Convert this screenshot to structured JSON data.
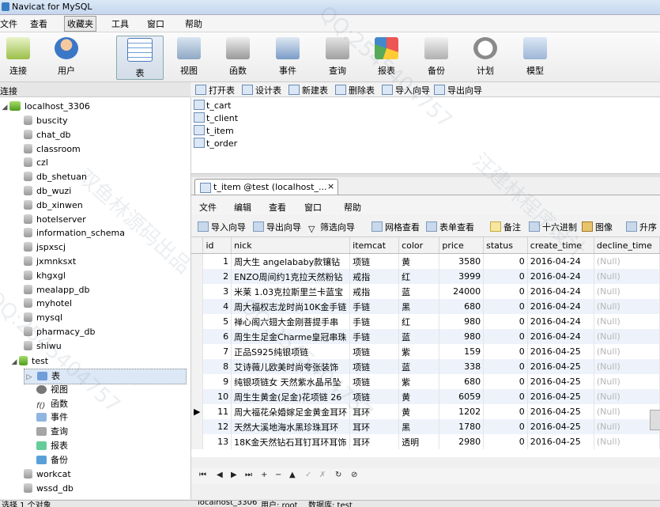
{
  "window": {
    "title": "Navicat for MySQL"
  },
  "menubar": [
    "文件",
    "查看",
    "收藏夹",
    "工具",
    "窗口",
    "帮助"
  ],
  "toolbar": [
    {
      "label": "连接",
      "icon": "plug-icon"
    },
    {
      "label": "用户",
      "icon": "user-icon"
    },
    {
      "label": "表",
      "icon": "table-icon"
    },
    {
      "label": "视图",
      "icon": "view-icon"
    },
    {
      "label": "函数",
      "icon": "function-icon"
    },
    {
      "label": "事件",
      "icon": "event-icon"
    },
    {
      "label": "查询",
      "icon": "query-icon"
    },
    {
      "label": "报表",
      "icon": "report-icon"
    },
    {
      "label": "备份",
      "icon": "backup-icon"
    },
    {
      "label": "计划",
      "icon": "schedule-icon"
    },
    {
      "label": "模型",
      "icon": "model-icon"
    }
  ],
  "left_header": "连接",
  "tree": {
    "connection": "localhost_3306",
    "databases": [
      "buscity",
      "chat_db",
      "classroom",
      "czl",
      "db_shetuan",
      "db_wuzi",
      "db_xinwen",
      "hotelserver",
      "information_schema",
      "jspxscj",
      "jxmnksxt",
      "khgxgl",
      "mealapp_db",
      "myhotel",
      "mysql",
      "pharmacy_db",
      "shiwu"
    ],
    "open_db": "test",
    "open_db_children": [
      "表",
      "视图",
      "函数",
      "事件",
      "查询",
      "报表",
      "备份"
    ],
    "after_dbs": [
      "workcat",
      "wssd_db"
    ]
  },
  "object_toolbar": [
    "打开表",
    "设计表",
    "新建表",
    "删除表",
    "导入向导",
    "导出向导"
  ],
  "tables": [
    "t_cart",
    "t_client",
    "t_item",
    "t_order"
  ],
  "tab": {
    "title": "t_item @test (localhost_...",
    "close": "×"
  },
  "editor_menu": [
    "文件",
    "编辑",
    "查看",
    "窗口",
    "帮助"
  ],
  "grid_toolbar": [
    "导入向导",
    "导出向导",
    "筛选向导",
    "网格查看",
    "表单查看",
    "备注",
    "十六进制",
    "图像",
    "升序"
  ],
  "grid": {
    "columns": [
      "id",
      "nick",
      "itemcat",
      "color",
      "price",
      "status",
      "create_time",
      "decline_time"
    ],
    "rows": [
      [
        "1",
        "周大生 angelababy款镶钻",
        "项链",
        "黄",
        "3580",
        "0",
        "2016-04-24",
        "(Null)"
      ],
      [
        "2",
        "ENZO周间约1克拉天然粉钻",
        "戒指",
        "红",
        "3999",
        "0",
        "2016-04-24",
        "(Null)"
      ],
      [
        "3",
        "米莱 1.03克拉斯里兰卡蓝宝",
        "戒指",
        "蓝",
        "24000",
        "0",
        "2016-04-24",
        "(Null)"
      ],
      [
        "4",
        "周大福权志龙时尚10K金手链",
        "手链",
        "黑",
        "680",
        "0",
        "2016-04-24",
        "(Null)"
      ],
      [
        "5",
        "禅心阁六翅大金刚菩提手串",
        "手链",
        "红",
        "980",
        "0",
        "2016-04-24",
        "(Null)"
      ],
      [
        "6",
        "周生生足金Charme皇冠串珠",
        "手链",
        "蓝",
        "980",
        "0",
        "2016-04-24",
        "(Null)"
      ],
      [
        "7",
        "正品S925纯银项链",
        "项链",
        "紫",
        "159",
        "0",
        "2016-04-25",
        "(Null)"
      ],
      [
        "8",
        "艾诗薇儿欧美时尚夸张装饰",
        "项链",
        "蓝",
        "338",
        "0",
        "2016-04-25",
        "(Null)"
      ],
      [
        "9",
        "纯银项链女 天然紫水晶吊坠",
        "项链",
        "紫",
        "680",
        "0",
        "2016-04-25",
        "(Null)"
      ],
      [
        "10",
        "周生生黄金(足金)花项链 26",
        "项链",
        "黄",
        "6059",
        "0",
        "2016-04-25",
        "(Null)"
      ],
      [
        "11",
        "周大福花朵婚嫁足金黄金耳环",
        "耳环",
        "黄",
        "1202",
        "0",
        "2016-04-25",
        "(Null)"
      ],
      [
        "12",
        "天然大溪地海水黑珍珠耳环",
        "耳环",
        "黑",
        "1780",
        "0",
        "2016-04-25",
        "(Null)"
      ],
      [
        "13",
        "18K金天然钻石耳钉耳环耳饰",
        "耳环",
        "透明",
        "2980",
        "0",
        "2016-04-25",
        "(Null)"
      ]
    ],
    "current_row": 10
  },
  "grid_nav": [
    "⏮",
    "◀",
    "▶",
    "⏭",
    "+",
    "−",
    "▲",
    "✓",
    "✗",
    "↻",
    "⊘"
  ],
  "statusbar": [
    "选择 1 个对象",
    "localhost_3306",
    "用户: root",
    "数据库: test"
  ],
  "watermarks": [
    "QQ:2545404757",
    "双鱼林源码出品",
    "汪建林程序设计"
  ],
  "colors": {
    "selected_row": "#dce8f6",
    "stripe": "#eef3fb",
    "null_text": "#b5b5b5"
  }
}
